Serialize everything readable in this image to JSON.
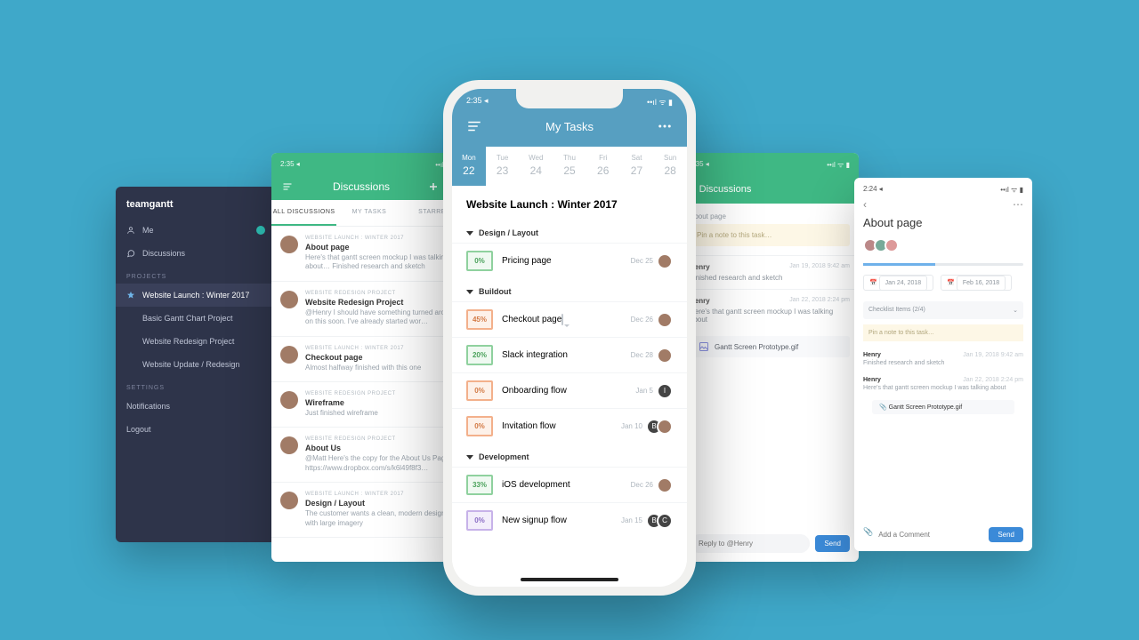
{
  "s1": {
    "brand": "teamgantt",
    "nav": [
      {
        "label": "Me"
      },
      {
        "label": "Discussions"
      }
    ],
    "section_projects": "Projects",
    "projects": [
      {
        "label": "Website Launch : Winter 2017",
        "active": true
      },
      {
        "label": "Basic Gantt Chart Project"
      },
      {
        "label": "Website Redesign Project"
      },
      {
        "label": "Website Update / Redesign"
      }
    ],
    "section_settings": "Settings",
    "settings": [
      {
        "label": "Notifications"
      },
      {
        "label": "Logout"
      }
    ]
  },
  "s2": {
    "time": "2:35 ◂",
    "title": "Discussions",
    "tabs": {
      "all": "All Discussions",
      "my": "My Tasks",
      "star": "Starred"
    },
    "items": [
      {
        "proj": "Website Launch : Winter 2017",
        "title": "About page",
        "preview": "Here's that gantt screen mockup I was talking about… Finished research and sketch"
      },
      {
        "proj": "Website Redesign Project",
        "title": "Website Redesign Project",
        "preview": "@Henry I should have something turned around on this soon. I've already started wor…"
      },
      {
        "proj": "Website Launch : Winter 2017",
        "title": "Checkout page",
        "preview": "Almost halfway finished with this one"
      },
      {
        "proj": "Website Redesign Project",
        "title": "Wireframe",
        "preview": "Just finished wireframe"
      },
      {
        "proj": "Website Redesign Project",
        "title": "About Us",
        "preview": "@Matt Here's the copy for the About Us Page https://www.dropbox.com/s/k6l49f8f3…"
      },
      {
        "proj": "Website Launch : Winter 2017",
        "title": "Design / Layout",
        "preview": "The customer wants a clean, modern design with large imagery"
      }
    ]
  },
  "phone": {
    "time": "2:35 ◂",
    "title": "My Tasks",
    "days": [
      {
        "name": "Mon",
        "num": "22",
        "active": true
      },
      {
        "name": "Tue",
        "num": "23"
      },
      {
        "name": "Wed",
        "num": "24"
      },
      {
        "name": "Thu",
        "num": "25"
      },
      {
        "name": "Fri",
        "num": "26"
      },
      {
        "name": "Sat",
        "num": "27"
      },
      {
        "name": "Sun",
        "num": "28"
      }
    ],
    "project": "Website Launch : Winter 2017",
    "groups": [
      {
        "name": "Design / Layout",
        "tasks": [
          {
            "pct": "0%",
            "cls": "green",
            "name": "Pricing page",
            "date": "Dec 25",
            "av": [
              "p"
            ]
          }
        ]
      },
      {
        "name": "Buildout",
        "tasks": [
          {
            "pct": "45%",
            "cls": "orange",
            "name": "Checkout page",
            "date": "Dec 26",
            "av": [
              "p"
            ],
            "comment": true
          },
          {
            "pct": "20%",
            "cls": "green",
            "name": "Slack integration",
            "date": "Dec 28",
            "av": [
              "p"
            ]
          },
          {
            "pct": "0%",
            "cls": "orange",
            "name": "Onboarding flow",
            "date": "Jan 5",
            "av": [
              "I"
            ]
          },
          {
            "pct": "0%",
            "cls": "orange",
            "name": "Invitation flow",
            "date": "Jan 10",
            "av": [
              "B",
              "p"
            ]
          }
        ]
      },
      {
        "name": "Development",
        "tasks": [
          {
            "pct": "33%",
            "cls": "green",
            "name": "iOS development",
            "date": "Dec 26",
            "av": [
              "p"
            ]
          },
          {
            "pct": "0%",
            "cls": "purple",
            "name": "New signup flow",
            "date": "Jan 15",
            "av": [
              "B",
              "C"
            ]
          }
        ]
      }
    ]
  },
  "s4": {
    "time": "2:35 ◂",
    "back": "Discussions",
    "task_label": "About page",
    "note_placeholder": "Pin a note to this task…",
    "comments": [
      {
        "who": "Henry",
        "date": "Jan 19, 2018  9:42 am",
        "text": "Finished research and sketch"
      },
      {
        "who": "Henry",
        "date": "Jan 22, 2018  2:24 pm",
        "text": "Here's that gantt screen mockup I was talking about"
      }
    ],
    "attachment": "Gantt Screen Prototype.gif",
    "reply_placeholder": "Reply to @Henry",
    "send": "Send"
  },
  "s5": {
    "time": "2:24 ◂",
    "title": "About page",
    "date_start": "Jan 24, 2018",
    "date_end": "Feb 16, 2018",
    "checklist": "Checklist Items   (2/4)",
    "pin": "Pin a note to this task…",
    "comments": [
      {
        "who": "Henry",
        "date": "Jan 19, 2018  9:42 am",
        "text": "Finished research and sketch"
      },
      {
        "who": "Henry",
        "date": "Jan 22, 2018  2:24 pm",
        "text": "Here's that gantt screen mockup I was talking about"
      }
    ],
    "attachment": "Gantt Screen Prototype.gif",
    "add_comment": "Add a Comment",
    "send": "Send"
  }
}
